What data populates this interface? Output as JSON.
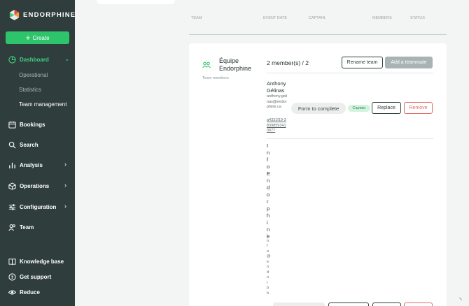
{
  "app": {
    "name": "ENDORPHINE"
  },
  "sidebar": {
    "create_label": "Create",
    "dashboard_label": "Dashboard",
    "sub_items": [
      "Operational",
      "Statistics",
      "Team management"
    ],
    "items": [
      "Bookings",
      "Search",
      "Analysis",
      "Operations",
      "Configuration",
      "Team"
    ],
    "footer": [
      "Knowledge base",
      "Get support",
      "Reduce"
    ]
  },
  "table": {
    "headers": [
      "TEAM",
      "EVENT DATE",
      "CAPTAIN",
      "MEMBERS",
      "STATUS"
    ]
  },
  "team": {
    "name": "Équipe Endorphine",
    "members_label": "Team members",
    "members_count": "2 member(s) / 2",
    "rename_label": "Rename team",
    "add_label": "Add a teammate"
  },
  "members": [
    {
      "name": "Anthony Gélinas",
      "email": "anthony.gelinas@endorphine.ca",
      "id": "a4331f19-38398593413077",
      "form_label": "Form to complete",
      "badge": "Captain",
      "replace_label": "Replace",
      "remove_label": "Remove"
    },
    {
      "name": "InfoEndorphine",
      "email": "info@endorph"
    }
  ],
  "colors": {
    "sidebar": "#2f3e3d",
    "accent": "#2ec46b",
    "danger": "#e26a6a"
  }
}
